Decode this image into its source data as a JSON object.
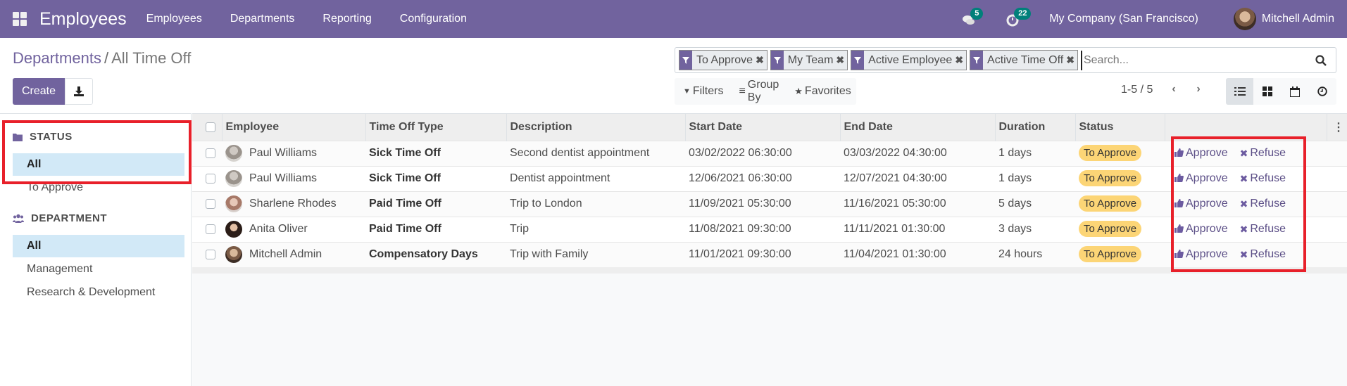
{
  "navbar": {
    "app_title": "Employees",
    "menu": [
      "Employees",
      "Departments",
      "Reporting",
      "Configuration"
    ],
    "messages_count": "5",
    "activities_count": "22",
    "company": "My Company (San Francisco)",
    "user": "Mitchell Admin"
  },
  "control_panel": {
    "breadcrumb_parent": "Departments",
    "breadcrumb_separator": "/",
    "breadcrumb_current": "All Time Off",
    "create_label": "Create",
    "facets": [
      "To Approve",
      "My Team",
      "Active Employee",
      "Active Time Off"
    ],
    "search_placeholder": "Search...",
    "filters_label": "Filters",
    "group_by_label": "Group By",
    "favorites_label": "Favorites",
    "pager": "1-5 / 5",
    "views": [
      "list",
      "kanban",
      "calendar",
      "activity"
    ],
    "active_view": "list"
  },
  "sidebar": {
    "status_title": "STATUS",
    "status_items": [
      {
        "label": "All",
        "active": true
      },
      {
        "label": "To Approve",
        "active": false
      }
    ],
    "department_title": "DEPARTMENT",
    "department_items": [
      {
        "label": "All",
        "active": true
      },
      {
        "label": "Management",
        "active": false
      },
      {
        "label": "Research & Development",
        "active": false
      }
    ]
  },
  "table": {
    "columns": [
      "Employee",
      "Time Off Type",
      "Description",
      "Start Date",
      "End Date",
      "Duration",
      "Status"
    ],
    "rows": [
      {
        "employee": "Paul Williams",
        "type": "Sick Time Off",
        "description": "Second dentist appointment",
        "start": "03/02/2022 06:30:00",
        "end": "03/03/2022 04:30:00",
        "duration": "1 days",
        "status": "To Approve"
      },
      {
        "employee": "Paul Williams",
        "type": "Sick Time Off",
        "description": "Dentist appointment",
        "start": "12/06/2021 06:30:00",
        "end": "12/07/2021 04:30:00",
        "duration": "1 days",
        "status": "To Approve"
      },
      {
        "employee": "Sharlene Rhodes",
        "type": "Paid Time Off",
        "description": "Trip to London",
        "start": "11/09/2021 05:30:00",
        "end": "11/16/2021 05:30:00",
        "duration": "5 days",
        "status": "To Approve"
      },
      {
        "employee": "Anita Oliver",
        "type": "Paid Time Off",
        "description": "Trip",
        "start": "11/08/2021 09:30:00",
        "end": "11/11/2021 01:30:00",
        "duration": "3 days",
        "status": "To Approve"
      },
      {
        "employee": "Mitchell Admin",
        "type": "Compensatory Days",
        "description": "Trip with Family",
        "start": "11/01/2021 09:30:00",
        "end": "11/04/2021 01:30:00",
        "duration": "24 hours",
        "status": "To Approve"
      }
    ],
    "approve_label": "Approve",
    "refuse_label": "Refuse"
  },
  "colors": {
    "brand": "#71639e",
    "badge": "#00807a",
    "status_to_approve": "#fcd576",
    "highlight": "#e8202a",
    "sidebar_active": "#d2e9f7"
  }
}
